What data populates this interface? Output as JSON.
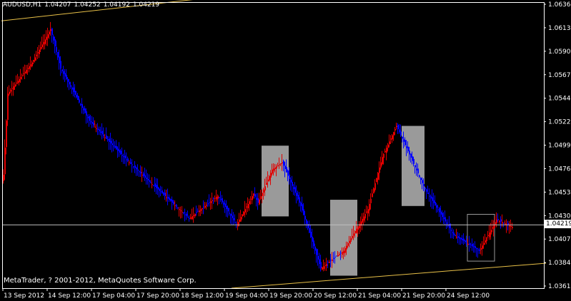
{
  "header": {
    "symbol": "AUDUSD,H1",
    "open": "1.04207",
    "high": "1.04252",
    "low": "1.04192",
    "close": "1.04219"
  },
  "footer": {
    "copyright": "MetaTrader, ? 2001-2012, MetaQuotes Software Corp."
  },
  "current_price": "1.04219",
  "colors": {
    "background": "#000000",
    "frame": "#ffffff",
    "bull_candle": "#e00000",
    "bear_candle": "#0000ff",
    "trendline": "#e8c048",
    "box_fill": "#9a9a9a",
    "price_line": "#c0c0c0"
  },
  "chart_data": {
    "type": "candlestick",
    "title": "AUDUSD,H1",
    "y_ticks": [
      "1.06360",
      "1.06135",
      "1.05905",
      "1.05675",
      "1.05445",
      "1.05220",
      "1.04990",
      "1.04760",
      "1.04530",
      "1.04305",
      "1.04075",
      "1.03845",
      "1.03615"
    ],
    "ylim": [
      1.0361,
      1.0636
    ],
    "x_tick_labels": [
      "13 Sep 2012",
      "14 Sep 12:00",
      "17 Sep 04:00",
      "17 Sep 20:00",
      "18 Sep 12:00",
      "19 Sep 04:00",
      "19 Sep 20:00",
      "20 Sep 12:00",
      "21 Sep 04:00",
      "21 Sep 20:00",
      "24 Sep 12:00"
    ],
    "close_path": [
      {
        "t": 0,
        "price": 1.047
      },
      {
        "t": 3,
        "price": 1.0548
      },
      {
        "t": 20,
        "price": 1.0578
      },
      {
        "t": 33,
        "price": 1.061
      },
      {
        "t": 40,
        "price": 1.0572
      },
      {
        "t": 60,
        "price": 1.0522
      },
      {
        "t": 82,
        "price": 1.049
      },
      {
        "t": 100,
        "price": 1.0466
      },
      {
        "t": 130,
        "price": 1.0428
      },
      {
        "t": 150,
        "price": 1.045
      },
      {
        "t": 163,
        "price": 1.0422
      },
      {
        "t": 175,
        "price": 1.0452
      },
      {
        "t": 178,
        "price": 1.0443
      },
      {
        "t": 188,
        "price": 1.0475
      },
      {
        "t": 195,
        "price": 1.0482
      },
      {
        "t": 208,
        "price": 1.044
      },
      {
        "t": 222,
        "price": 1.038
      },
      {
        "t": 238,
        "price": 1.0397
      },
      {
        "t": 255,
        "price": 1.0437
      },
      {
        "t": 265,
        "price": 1.0487
      },
      {
        "t": 275,
        "price": 1.0517
      },
      {
        "t": 295,
        "price": 1.0456
      },
      {
        "t": 315,
        "price": 1.0412
      },
      {
        "t": 333,
        "price": 1.0397
      },
      {
        "t": 345,
        "price": 1.0427
      },
      {
        "t": 356,
        "price": 1.042
      }
    ],
    "trendlines": [
      {
        "x1": -1,
        "p1": 1.0618,
        "x2": 150,
        "p2": 1.0641
      },
      {
        "x1": 160,
        "p1": 1.0361,
        "x2": 380,
        "p2": 1.0385
      }
    ],
    "boxes": [
      {
        "x0": 181,
        "x1": 200,
        "p_top": 1.0498,
        "p_bot": 1.043,
        "filled": true
      },
      {
        "x0": 229,
        "x1": 248,
        "p_top": 1.0446,
        "p_bot": 1.0373,
        "filled": true
      },
      {
        "x0": 279,
        "x1": 295,
        "p_top": 1.0517,
        "p_bot": 1.044,
        "filled": true
      },
      {
        "x0": 325,
        "x1": 344,
        "p_top": 1.0432,
        "p_bot": 1.0387,
        "filled": false
      }
    ],
    "current_price": 1.04219
  }
}
